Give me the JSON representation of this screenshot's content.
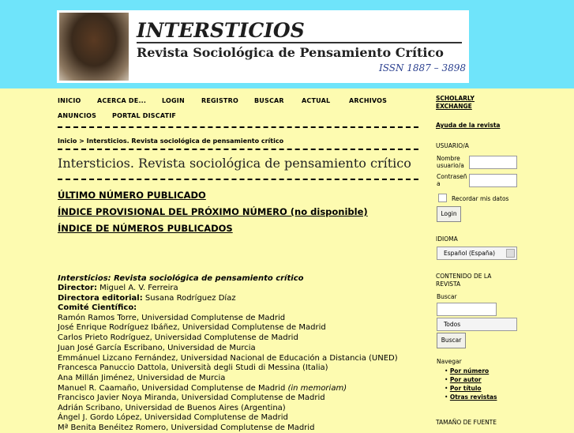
{
  "header": {
    "title": "INTERSTICIOS",
    "subtitle": "Revista Sociológica de Pensamiento Crítico",
    "issn": "ISSN 1887 – 3898"
  },
  "nav": {
    "items": [
      "INICIO",
      "ACERCA DE...",
      "LOGIN",
      "REGISTRO",
      "BUSCAR",
      "ACTUAL",
      "ARCHIVOS",
      "ANUNCIOS",
      "PORTAL DISCATIF"
    ]
  },
  "breadcrumb": "Inicio > Intersticios. Revista sociológica de pensamiento crítico",
  "page_title": "Intersticios. Revista sociológica de pensamiento crítico",
  "links": {
    "latest_issue": "ÚLTIMO NÚMERO PUBLICADO",
    "next_issue": "ÍNDICE PROVISIONAL DEL PRÓXIMO NÚMERO (no disponible)",
    "issue_index": "ÍNDICE DE NÚMEROS PUBLICADOS"
  },
  "content": {
    "journal_name": "Intersticios: Revista sociológica de pensamiento crítico",
    "director_label": "Director:",
    "director": "Miguel A. V. Ferreira",
    "editorial_director_label": "Directora editorial:",
    "editorial_director": "Susana Rodríguez Díaz",
    "committee_label": "Comité Científico:",
    "committee": [
      "Ramón Ramos Torre, Universidad Complutense de Madrid",
      "José Enrique Rodríguez Ibáñez, Universidad Complutense de Madrid",
      "Carlos Prieto Rodríguez, Universidad Complutense de Madrid",
      "Juan José García Escribano, Universidad de Murcia",
      "Emmánuel Lizcano Fernández, Universidad Nacional de Educación a Distancia (UNED)",
      "Francesca Panuccio Dattola, Università degli Studi di Messina (Italia)",
      "Ana Millán Jiménez, Universidad de Murcia",
      "Manuel R. Caamaño, Universidad Complutense de Madrid",
      "Francisco Javier Noya Miranda, Universidad Complutense de Madrid",
      "Adrián Scribano, Universidad de Buenos Aires (Argentina)",
      "Ángel J. Gordo López, Universidad Complutense de Madrid",
      "Mª Benita Benéitez Romero, Universidad Complutense de Madrid"
    ],
    "memoriam_note": "(in memoriam)"
  },
  "sidebar": {
    "scholarly_exchange": [
      "SCHOLARLY",
      "EXCHANGE"
    ],
    "help": "Ayuda de la revista",
    "user_heading": "USUARIO/A",
    "username_label": [
      "Nombre",
      "usuario/a"
    ],
    "password_label": [
      "Contraseñ",
      "a"
    ],
    "remember_label": "Recordar mis datos",
    "login_button": "Login",
    "language_heading": "IDIOMA",
    "language_value": "Español (España)",
    "content_heading": [
      "CONTENIDO DE LA",
      "REVISTA"
    ],
    "search_label": "Buscar",
    "search_scope": "Todos",
    "search_button": "Buscar",
    "browse_heading": "Navegar",
    "browse_items": [
      "Por número",
      "Por autor",
      "Por título",
      "Otras revistas"
    ],
    "font_size_heading": "TAMAÑO DE FUENTE"
  }
}
